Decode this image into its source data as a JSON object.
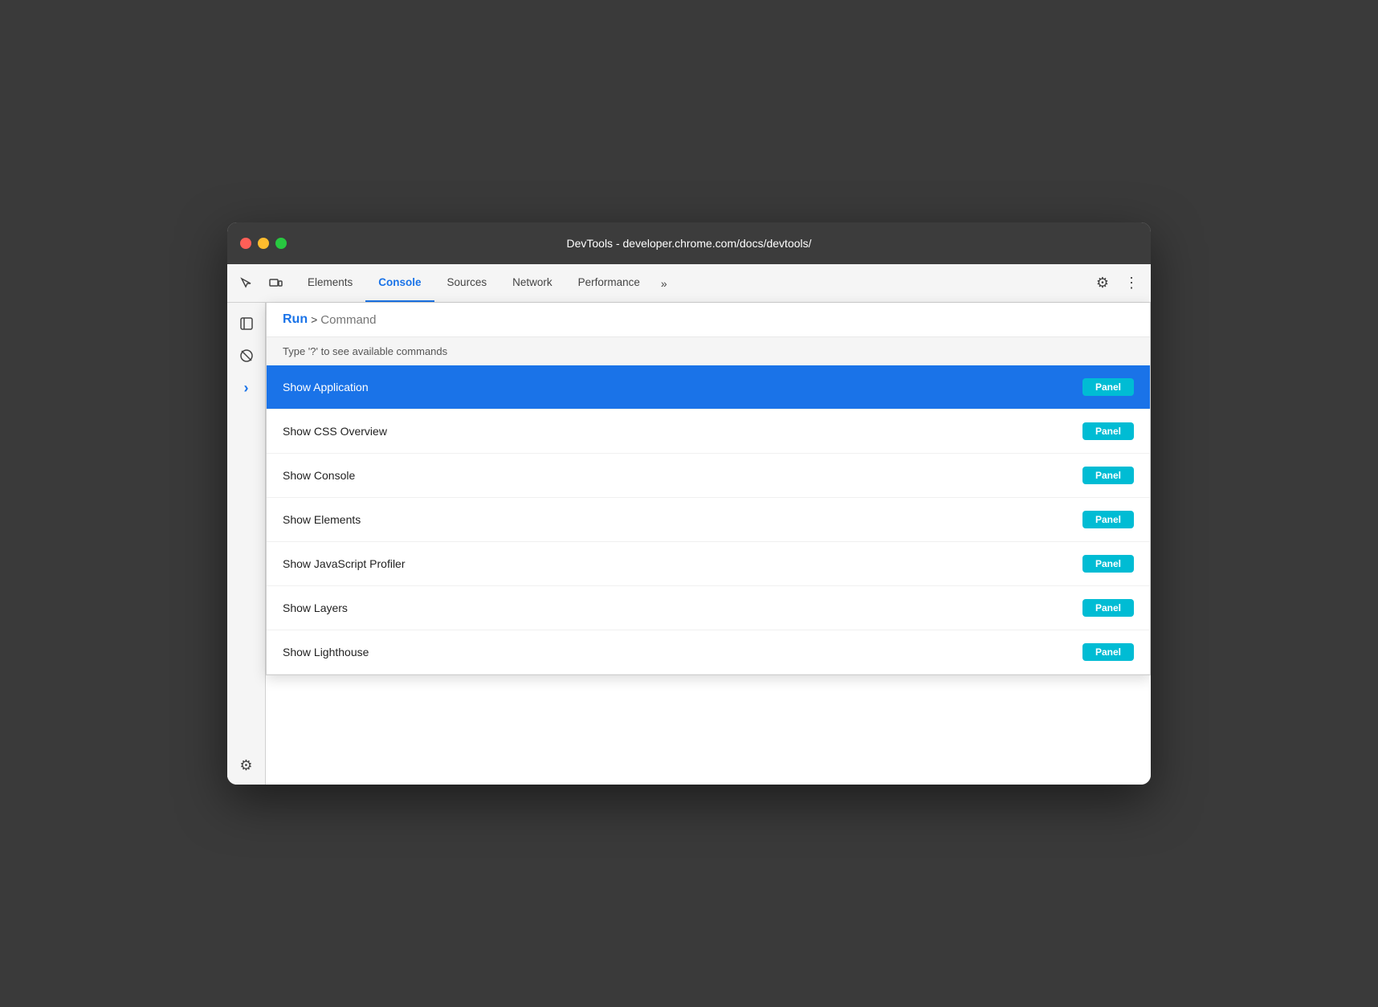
{
  "window": {
    "title": "DevTools - developer.chrome.com/docs/devtools/"
  },
  "traffic_lights": {
    "close": "close",
    "minimize": "minimize",
    "maximize": "maximize"
  },
  "tabs": [
    {
      "id": "elements",
      "label": "Elements",
      "active": false
    },
    {
      "id": "console",
      "label": "Console",
      "active": true
    },
    {
      "id": "sources",
      "label": "Sources",
      "active": false
    },
    {
      "id": "network",
      "label": "Network",
      "active": false
    },
    {
      "id": "performance",
      "label": "Performance",
      "active": false
    }
  ],
  "tab_overflow_label": "»",
  "toolbar": {
    "settings_label": "⚙",
    "more_label": "⋮"
  },
  "side_toolbar": {
    "panel_toggle": "▶",
    "no_recording": "⊘",
    "chevron": "›"
  },
  "command_palette": {
    "run_label": "Run",
    "chevron": ">",
    "input_placeholder": "Command",
    "hint_text": "Type '?' to see available commands",
    "panel_badge_label": "Panel"
  },
  "commands": [
    {
      "id": "show-application",
      "name": "Show Application",
      "badge": "Panel",
      "selected": true
    },
    {
      "id": "show-css-overview",
      "name": "Show CSS Overview",
      "badge": "Panel",
      "selected": false
    },
    {
      "id": "show-console",
      "name": "Show Console",
      "badge": "Panel",
      "selected": false
    },
    {
      "id": "show-elements",
      "name": "Show Elements",
      "badge": "Panel",
      "selected": false
    },
    {
      "id": "show-javascript-profiler",
      "name": "Show JavaScript Profiler",
      "badge": "Panel",
      "selected": false
    },
    {
      "id": "show-layers",
      "name": "Show Layers",
      "badge": "Panel",
      "selected": false
    },
    {
      "id": "show-lighthouse",
      "name": "Show Lighthouse",
      "badge": "Panel",
      "selected": false
    }
  ],
  "colors": {
    "accent_blue": "#1a73e8",
    "selected_bg": "#1a73e8",
    "badge_teal": "#00bcd4"
  }
}
